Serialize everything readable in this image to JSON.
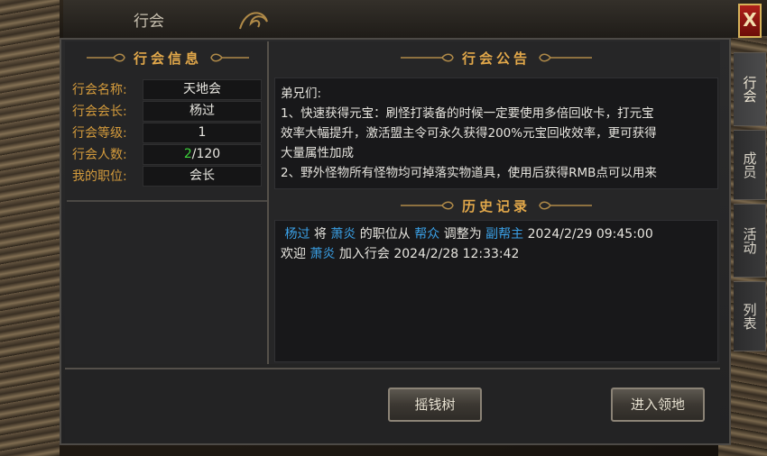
{
  "window": {
    "title": "行会",
    "close_label": "X"
  },
  "guild_info": {
    "heading": "行会信息",
    "rows": [
      {
        "label": "行会名称:",
        "value": "天地会"
      },
      {
        "label": "行会会长:",
        "value": "杨过"
      },
      {
        "label": "行会等级:",
        "value": "1"
      },
      {
        "label": "行会人数:",
        "value_current": "2",
        "value_max": "/120"
      },
      {
        "label": "我的职位:",
        "value": "会长"
      }
    ]
  },
  "notice": {
    "heading": "行会公告",
    "lines": [
      "弟兄们:",
      "1、快速获得元宝：刷怪打装备的时候一定要使用多倍回收卡，打元宝",
      "效率大幅提升，激活盟主令可永久获得200%元宝回收效率，更可获得",
      "大量属性加成",
      "2、野外怪物所有怪物均可掉落实物道具，使用后获得RMB点可以用来"
    ]
  },
  "history": {
    "heading": "历史记录",
    "entries": [
      {
        "p1": "杨过",
        "t1": " 将 ",
        "p2": "萧炎",
        "t2": " 的职位从 ",
        "p3": "帮众",
        "t3": " 调整为 ",
        "p4": "副帮主",
        "t4": " 2024/2/29 09:45:00"
      },
      {
        "t0": "欢迎 ",
        "p1": "萧炎",
        "t1": " 加入行会 2024/2/28 12:33:42"
      }
    ]
  },
  "buttons": {
    "money_tree": "摇钱树",
    "enter_territory": "进入领地"
  },
  "side_tabs": [
    {
      "label": "行会",
      "active": true
    },
    {
      "label": "成员",
      "active": false
    },
    {
      "label": "活动",
      "active": false
    },
    {
      "label": "列表",
      "active": false
    }
  ],
  "colors": {
    "accent_gold": "#d49b3c",
    "heading_orange": "#e2a84a",
    "name_blue": "#3aa0e6",
    "count_green": "#3ed43c",
    "close_red": "#b0201a"
  }
}
